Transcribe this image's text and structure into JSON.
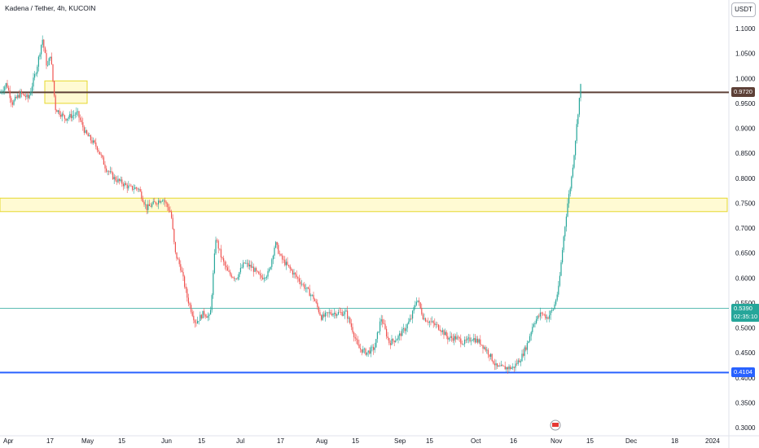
{
  "header": {
    "symbol_title": "Kadena / Tether, 4h, KUCOIN"
  },
  "toolbar": {
    "currency_label": "USDT"
  },
  "price_tags": {
    "resistance": {
      "label": "0.9720",
      "color": "#5d4037"
    },
    "current": {
      "label": "0.5390",
      "sub": "02:35:10",
      "color": "#26a69a"
    },
    "support": {
      "label": "0.4104",
      "color": "#2962ff"
    }
  },
  "chart_data": {
    "type": "candlestick",
    "y_ticks": [
      "1.1000",
      "1.0500",
      "1.0000",
      "0.9500",
      "0.9000",
      "0.8500",
      "0.8000",
      "0.7500",
      "0.7000",
      "0.6500",
      "0.6000",
      "0.5500",
      "0.5000",
      "0.4500",
      "0.4000",
      "0.3500",
      "0.3000"
    ],
    "x_ticks": [
      "Apr",
      "17",
      "May",
      "15",
      "Jun",
      "15",
      "Jul",
      "17",
      "Aug",
      "15",
      "Sep",
      "15",
      "Oct",
      "16",
      "Nov",
      "15",
      "Dec",
      "18",
      "2024"
    ],
    "ylim": [
      0.3,
      1.1
    ],
    "horizontal_lines": [
      {
        "value": 0.972,
        "color": "#5d4037"
      },
      {
        "value": 0.539,
        "color": "#26a69a"
      },
      {
        "value": 0.4104,
        "color": "#2962ff"
      }
    ],
    "zones": [
      {
        "from": 0.95,
        "to": 0.995,
        "color": "#fff59d"
      },
      {
        "from": 0.733,
        "to": 0.76,
        "color": "#fff59d"
      }
    ],
    "path_points": [
      [
        0,
        0.97
      ],
      [
        8,
        0.99
      ],
      [
        15,
        0.95
      ],
      [
        25,
        0.97
      ],
      [
        35,
        0.96
      ],
      [
        45,
        1.02
      ],
      [
        52,
        1.08
      ],
      [
        58,
        1.02
      ],
      [
        62,
        1.05
      ],
      [
        68,
        0.94
      ],
      [
        80,
        0.92
      ],
      [
        95,
        0.93
      ],
      [
        105,
        0.89
      ],
      [
        120,
        0.86
      ],
      [
        130,
        0.82
      ],
      [
        140,
        0.8
      ],
      [
        150,
        0.79
      ],
      [
        160,
        0.78
      ],
      [
        170,
        0.78
      ],
      [
        180,
        0.74
      ],
      [
        190,
        0.75
      ],
      [
        200,
        0.76
      ],
      [
        210,
        0.73
      ],
      [
        215,
        0.65
      ],
      [
        222,
        0.62
      ],
      [
        230,
        0.56
      ],
      [
        240,
        0.51
      ],
      [
        250,
        0.53
      ],
      [
        258,
        0.52
      ],
      [
        265,
        0.68
      ],
      [
        272,
        0.64
      ],
      [
        280,
        0.61
      ],
      [
        290,
        0.6
      ],
      [
        300,
        0.63
      ],
      [
        310,
        0.62
      ],
      [
        320,
        0.6
      ],
      [
        330,
        0.61
      ],
      [
        338,
        0.67
      ],
      [
        345,
        0.64
      ],
      [
        355,
        0.62
      ],
      [
        365,
        0.6
      ],
      [
        375,
        0.58
      ],
      [
        385,
        0.56
      ],
      [
        395,
        0.52
      ],
      [
        405,
        0.53
      ],
      [
        415,
        0.53
      ],
      [
        425,
        0.53
      ],
      [
        432,
        0.5
      ],
      [
        440,
        0.46
      ],
      [
        450,
        0.45
      ],
      [
        460,
        0.46
      ],
      [
        468,
        0.52
      ],
      [
        478,
        0.47
      ],
      [
        488,
        0.48
      ],
      [
        498,
        0.5
      ],
      [
        505,
        0.52
      ],
      [
        512,
        0.56
      ],
      [
        520,
        0.52
      ],
      [
        530,
        0.51
      ],
      [
        540,
        0.5
      ],
      [
        550,
        0.48
      ],
      [
        560,
        0.48
      ],
      [
        570,
        0.47
      ],
      [
        580,
        0.48
      ],
      [
        590,
        0.47
      ],
      [
        600,
        0.45
      ],
      [
        610,
        0.42
      ],
      [
        620,
        0.42
      ],
      [
        630,
        0.42
      ],
      [
        640,
        0.44
      ],
      [
        648,
        0.47
      ],
      [
        655,
        0.51
      ],
      [
        665,
        0.53
      ],
      [
        672,
        0.52
      ],
      [
        680,
        0.54
      ],
      [
        686,
        0.58
      ],
      [
        692,
        0.68
      ],
      [
        697,
        0.75
      ],
      [
        701,
        0.79
      ],
      [
        705,
        0.85
      ],
      [
        709,
        0.92
      ],
      [
        712,
        0.97
      ],
      [
        714,
        1.0
      ]
    ]
  }
}
